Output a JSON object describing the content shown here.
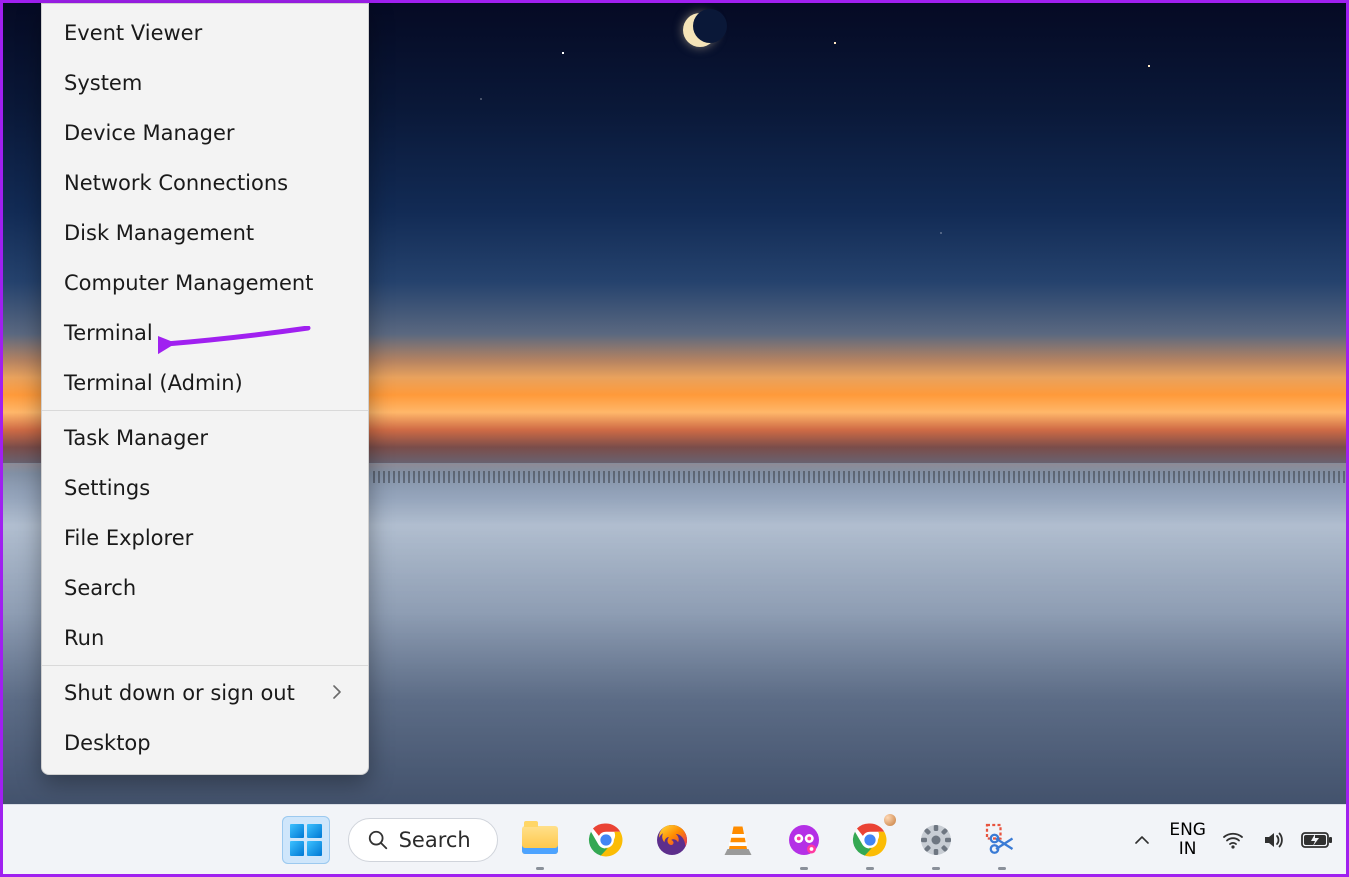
{
  "context_menu": {
    "groups": [
      {
        "items": [
          {
            "id": "event-viewer",
            "label": "Event Viewer"
          },
          {
            "id": "system",
            "label": "System"
          },
          {
            "id": "device-manager",
            "label": "Device Manager"
          },
          {
            "id": "network-connections",
            "label": "Network Connections"
          },
          {
            "id": "disk-management",
            "label": "Disk Management"
          },
          {
            "id": "computer-management",
            "label": "Computer Management"
          },
          {
            "id": "terminal",
            "label": "Terminal"
          },
          {
            "id": "terminal-admin",
            "label": "Terminal (Admin)"
          }
        ]
      },
      {
        "items": [
          {
            "id": "task-manager",
            "label": "Task Manager"
          },
          {
            "id": "settings",
            "label": "Settings"
          },
          {
            "id": "file-explorer",
            "label": "File Explorer"
          },
          {
            "id": "search",
            "label": "Search"
          },
          {
            "id": "run",
            "label": "Run"
          }
        ]
      },
      {
        "items": [
          {
            "id": "shutdown",
            "label": "Shut down or sign out",
            "submenu": true
          },
          {
            "id": "desktop",
            "label": "Desktop"
          }
        ]
      }
    ]
  },
  "annotation": {
    "target": "terminal",
    "color": "#a020f0"
  },
  "taskbar": {
    "search_label": "Search",
    "pinned": [
      {
        "id": "start",
        "name": "start-button",
        "running": false
      },
      {
        "id": "search",
        "name": "search-button",
        "running": false
      },
      {
        "id": "explorer",
        "name": "file-explorer-icon",
        "running": true
      },
      {
        "id": "chrome",
        "name": "chrome-icon",
        "running": false
      },
      {
        "id": "firefox",
        "name": "firefox-icon",
        "running": false
      },
      {
        "id": "vlc",
        "name": "vlc-icon",
        "running": false
      },
      {
        "id": "app-purple",
        "name": "screen-recorder-icon",
        "running": true
      },
      {
        "id": "chrome-profile",
        "name": "chrome-profile-icon",
        "running": true
      },
      {
        "id": "settings",
        "name": "settings-icon",
        "running": true
      },
      {
        "id": "snip",
        "name": "snipping-tool-icon",
        "running": true
      }
    ],
    "tray": {
      "overflow_icon": "chevron-up-icon",
      "language_top": "ENG",
      "language_bottom": "IN",
      "wifi_icon": "wifi-icon",
      "volume_icon": "volume-icon",
      "battery_icon": "battery-icon"
    }
  }
}
